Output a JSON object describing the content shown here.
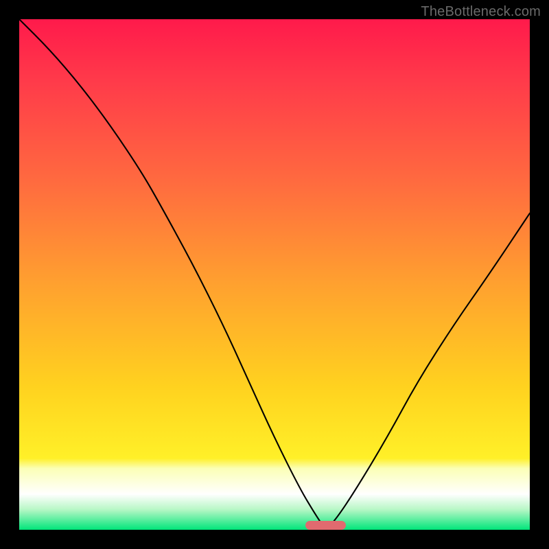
{
  "attribution": "TheBottleneck.com",
  "chart_data": {
    "type": "line",
    "title": "",
    "xlabel": "",
    "ylabel": "",
    "xlim": [
      0,
      100
    ],
    "ylim": [
      0,
      100
    ],
    "series": [
      {
        "name": "bottleneck-curve",
        "x": [
          0,
          6,
          12,
          18,
          24,
          28,
          34,
          40,
          45,
          50,
          55,
          58,
          60,
          62,
          66,
          72,
          78,
          85,
          92,
          100
        ],
        "values": [
          100,
          94,
          87,
          79,
          70,
          63,
          52,
          40,
          29,
          18,
          8,
          3,
          0,
          2,
          8,
          18,
          29,
          40,
          50,
          62
        ]
      }
    ],
    "annotations": [
      {
        "name": "zero-bottleneck-marker",
        "x_start": 56,
        "x_end": 64,
        "y": 0
      }
    ],
    "background_gradient": {
      "stops": [
        {
          "pct": 0,
          "color": "#ff1a4b"
        },
        {
          "pct": 50,
          "color": "#ffa12f"
        },
        {
          "pct": 86,
          "color": "#fff028"
        },
        {
          "pct": 93,
          "color": "#ffffff"
        },
        {
          "pct": 100,
          "color": "#00e57a"
        }
      ]
    }
  }
}
